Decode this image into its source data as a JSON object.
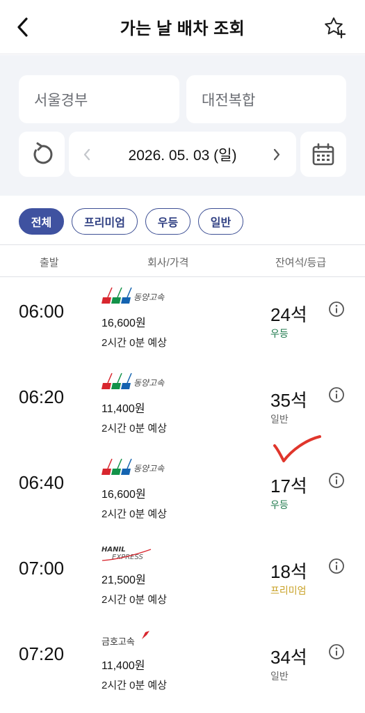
{
  "header": {
    "title": "가는 날 배차 조회"
  },
  "search": {
    "departure": "서울경부",
    "arrival": "대전복합",
    "date": "2026. 05. 03 (일)"
  },
  "filters": [
    "전체",
    "프리미엄",
    "우등",
    "일반"
  ],
  "columns": {
    "departure": "출발",
    "company_price": "회사/가격",
    "seats_grade": "잔여석/등급"
  },
  "buses": [
    {
      "time": "06:00",
      "company": "동양고속",
      "price": "16,600원",
      "duration": "2시간 0분 예상",
      "seats": "24석",
      "grade": "우등"
    },
    {
      "time": "06:20",
      "company": "동양고속",
      "price": "11,400원",
      "duration": "2시간 0분 예상",
      "seats": "35석",
      "grade": "일반"
    },
    {
      "time": "06:40",
      "company": "동양고속",
      "price": "16,600원",
      "duration": "2시간 0분 예상",
      "seats": "17석",
      "grade": "우등"
    },
    {
      "time": "07:00",
      "company": "HANIL EXPRESS",
      "price": "21,500원",
      "duration": "2시간 0분 예상",
      "seats": "18석",
      "grade": "프리미엄"
    },
    {
      "time": "07:20",
      "company": "금호고속",
      "price": "11,400원",
      "duration": "2시간 0분 예상",
      "seats": "34석",
      "grade": "일반"
    }
  ],
  "logos": {
    "dongyang": "동양고속",
    "hanil_top": "HANIL",
    "hanil_bottom": "EXPRESS",
    "kumho": "금호고속"
  },
  "colors": {
    "accent": "#3f52a0",
    "grade_udeung": "#1f7a4d",
    "grade_ilban": "#666666",
    "grade_premium": "#c9a227",
    "annotation": "#e0362c"
  },
  "icons": {
    "back": "chevron-left-icon",
    "favorite": "star-plus-icon",
    "refresh": "refresh-icon",
    "calendar": "calendar-icon",
    "info": "info-circle-icon"
  }
}
